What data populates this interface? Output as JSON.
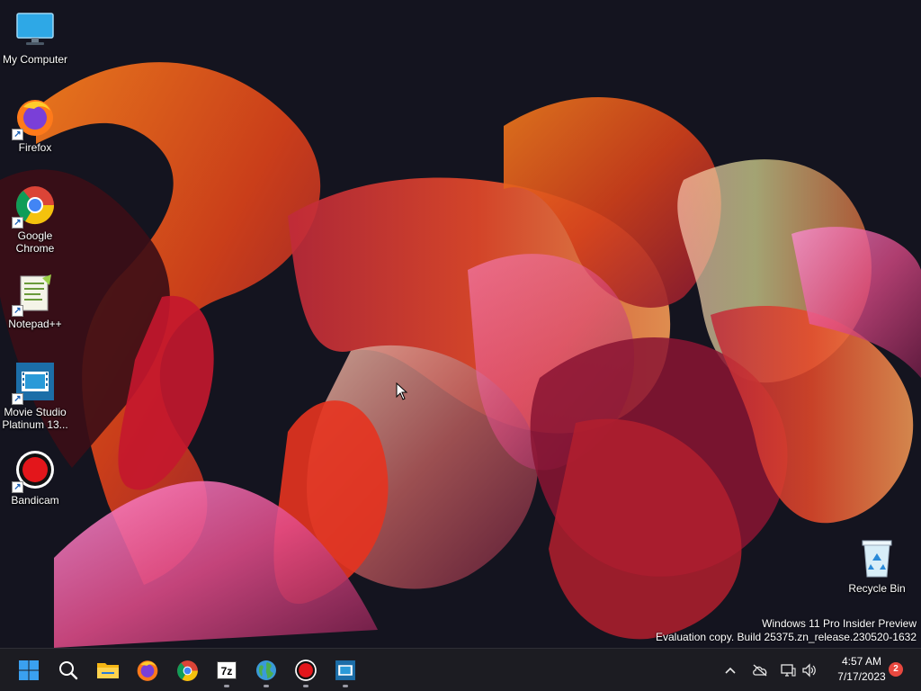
{
  "desktop": {
    "icons": [
      {
        "label": "My Computer",
        "icon": "monitor-icon"
      },
      {
        "label": "Firefox",
        "icon": "firefox-icon"
      },
      {
        "label": "Google Chrome",
        "icon": "chrome-icon"
      },
      {
        "label": "Notepad++",
        "icon": "notepadpp-icon"
      },
      {
        "label": "Movie Studio Platinum 13...",
        "icon": "movie-studio-icon"
      },
      {
        "label": "Bandicam",
        "icon": "bandicam-icon"
      }
    ],
    "recycle_bin": {
      "label": "Recycle Bin",
      "icon": "recycle-bin-icon"
    }
  },
  "watermark": {
    "line1": "Windows 11 Pro Insider Preview",
    "line2": "Evaluation copy. Build 25375.zn_release.230520-1632"
  },
  "taskbar": {
    "apps": [
      {
        "name": "Start",
        "icon": "windows-start-icon"
      },
      {
        "name": "Search",
        "icon": "search-icon"
      },
      {
        "name": "File Explorer",
        "icon": "folder-icon"
      },
      {
        "name": "Firefox",
        "icon": "firefox-icon"
      },
      {
        "name": "Google Chrome",
        "icon": "chrome-icon"
      },
      {
        "name": "7-Zip",
        "icon": "7zip-icon",
        "label": "7z"
      },
      {
        "name": "Network app",
        "icon": "globe-icon"
      },
      {
        "name": "Bandicam",
        "icon": "bandicam-icon"
      },
      {
        "name": "Movie Studio",
        "icon": "movie-studio-icon"
      }
    ],
    "tray": {
      "time": "4:57 AM",
      "date": "7/17/2023",
      "notification_count": "2"
    }
  },
  "colors": {
    "taskbar_bg": "#1c1c22",
    "accent_blue": "#0078d4",
    "notification_badge": "#e8483f"
  }
}
